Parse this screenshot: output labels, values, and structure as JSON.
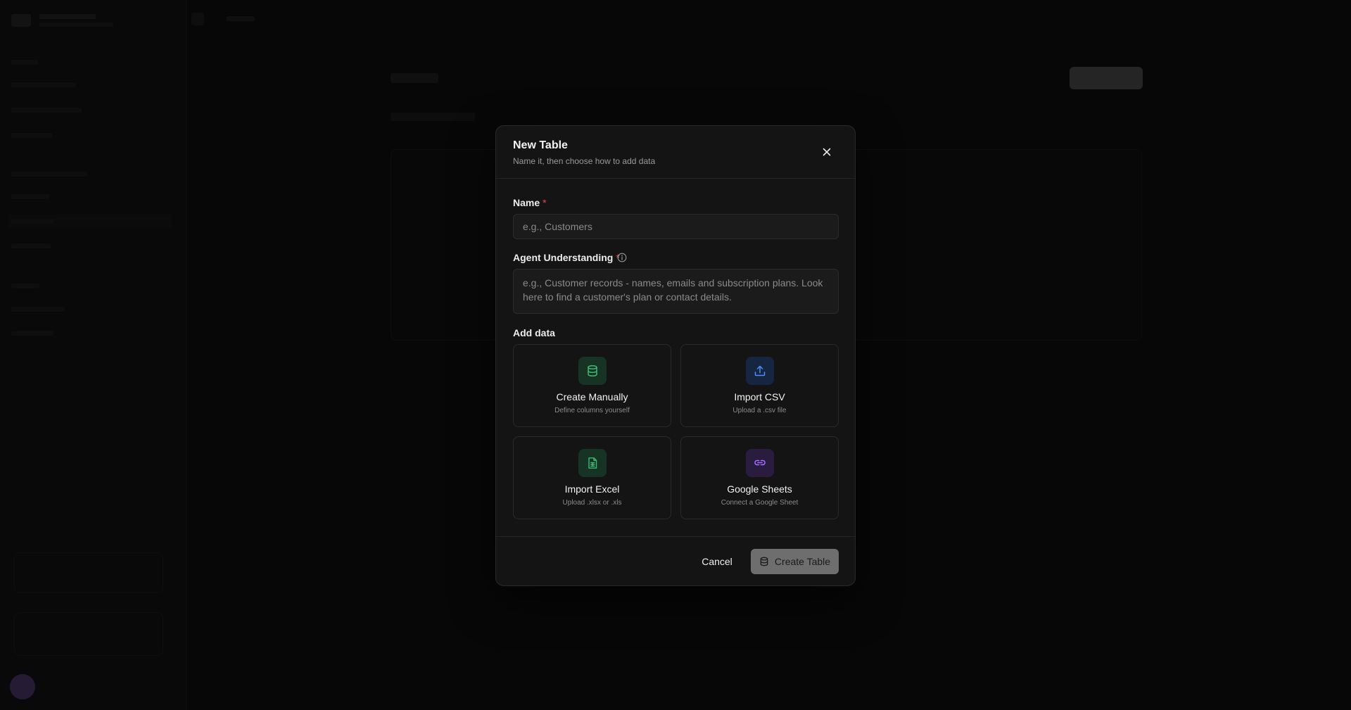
{
  "modal": {
    "title": "New Table",
    "subtitle": "Name it, then choose how to add data",
    "name_field": {
      "label": "Name",
      "required_mark": "*",
      "placeholder": "e.g., Customers",
      "value": ""
    },
    "agent_field": {
      "label": "Agent Understanding",
      "required_mark": "*",
      "placeholder": "e.g., Customer records - names, emails and subscription plans. Look here to find a customer's plan or contact details.",
      "value": ""
    },
    "add_data_label": "Add data",
    "options": [
      {
        "title": "Create Manually",
        "subtitle": "Define columns yourself",
        "icon": "database-icon",
        "accent": "#3fb874",
        "icon_bg": "#163324"
      },
      {
        "title": "Import CSV",
        "subtitle": "Upload a .csv file",
        "icon": "upload-icon",
        "accent": "#4c8dff",
        "icon_bg": "#162640"
      },
      {
        "title": "Import Excel",
        "subtitle": "Upload .xlsx or .xls",
        "icon": "spreadsheet-icon",
        "accent": "#3fb874",
        "icon_bg": "#163324"
      },
      {
        "title": "Google Sheets",
        "subtitle": "Connect a Google Sheet",
        "icon": "link-icon",
        "accent": "#a56bff",
        "icon_bg": "#2a1c3f"
      }
    ],
    "cancel_label": "Cancel",
    "create_label": "Create Table"
  },
  "colors": {
    "required": "#e5484d",
    "create_button_bg": "#6e6e6e"
  }
}
